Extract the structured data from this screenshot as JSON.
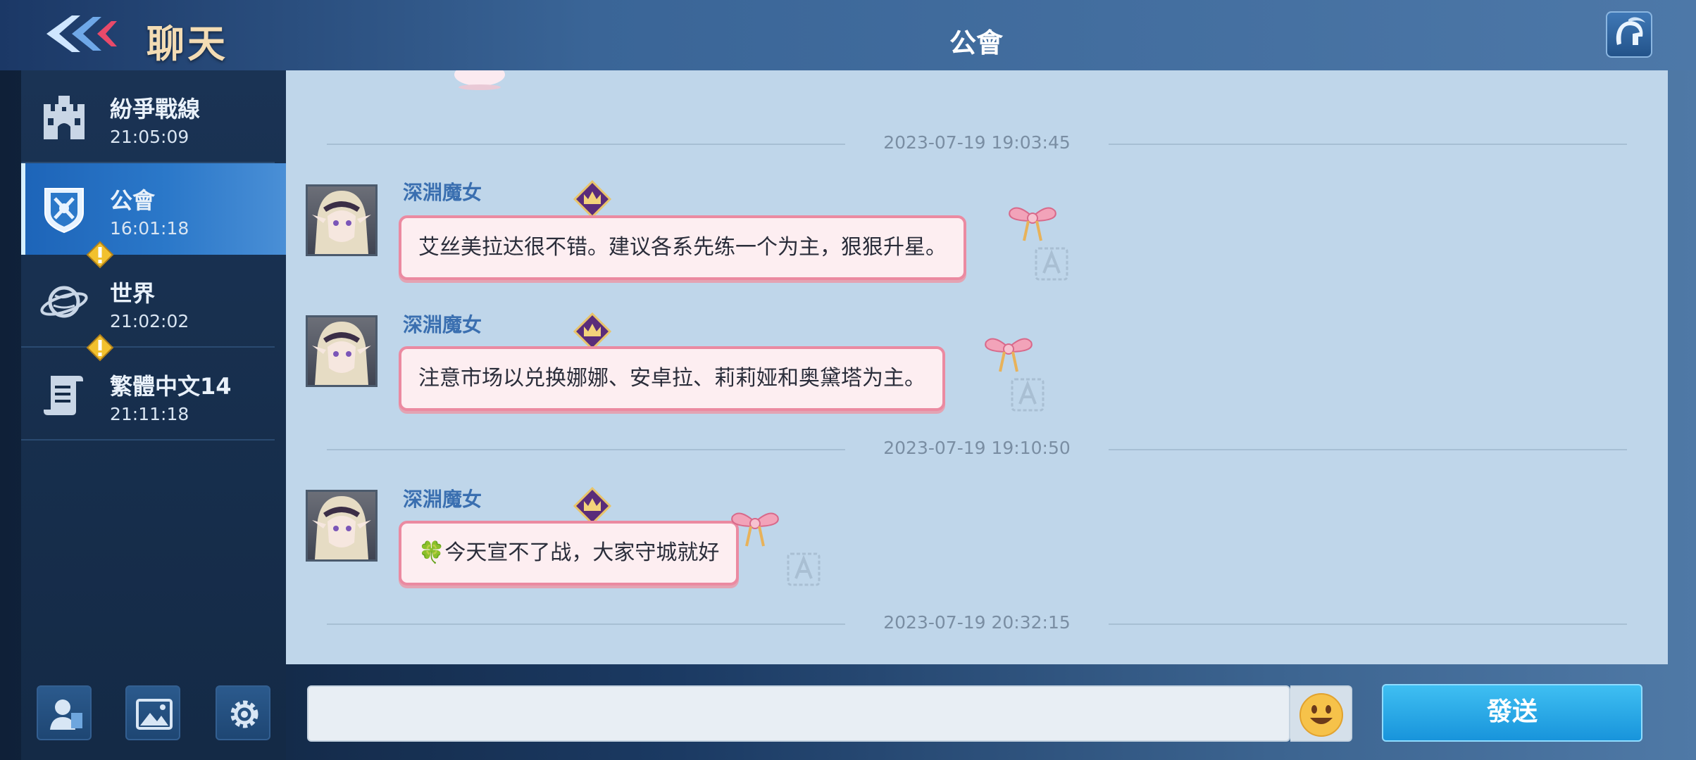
{
  "header": {
    "app_title": "聊天",
    "channel_title": "公會",
    "back_icon": "back-arrow-icon",
    "right_icon": "spartan-helmet-icon"
  },
  "sidebar": {
    "channels": [
      {
        "name": "紛爭戰線",
        "time": "21:05:09",
        "icon": "castle-icon",
        "active": false,
        "alert": false
      },
      {
        "name": "公會",
        "time": "16:01:18",
        "icon": "guild-shield-icon",
        "active": true,
        "alert": false
      },
      {
        "name": "世界",
        "time": "21:02:02",
        "icon": "planet-icon",
        "active": false,
        "alert": true
      },
      {
        "name": "繁體中文14",
        "time": "21:11:18",
        "icon": "scroll-icon",
        "active": false,
        "alert": true
      }
    ],
    "bottom_buttons": [
      "profile-icon",
      "image-icon",
      "gear-icon"
    ]
  },
  "chat": {
    "timestamps": [
      "2023-07-19 19:03:45",
      "2023-07-19 19:10:50",
      "2023-07-19 20:32:15"
    ],
    "messages": [
      {
        "sender": "深淵魔女",
        "text": "艾丝美拉达很不错。建议各系先练一个为主，狠狠升星。"
      },
      {
        "sender": "深淵魔女",
        "text": "注意市场以兑换娜娜、安卓拉、莉莉娅和奥黛塔为主。"
      },
      {
        "sender": "深淵魔女",
        "text": "🍀今天宣不了战，大家守城就好"
      }
    ]
  },
  "input": {
    "value": "",
    "placeholder": "",
    "send_label": "發送"
  },
  "colors": {
    "accent": "#1b93db",
    "bubble_border": "#eb8aa1",
    "sender_name": "#3a6fb0",
    "active_channel": "#2b78c9",
    "alert": "#f2c12e"
  }
}
